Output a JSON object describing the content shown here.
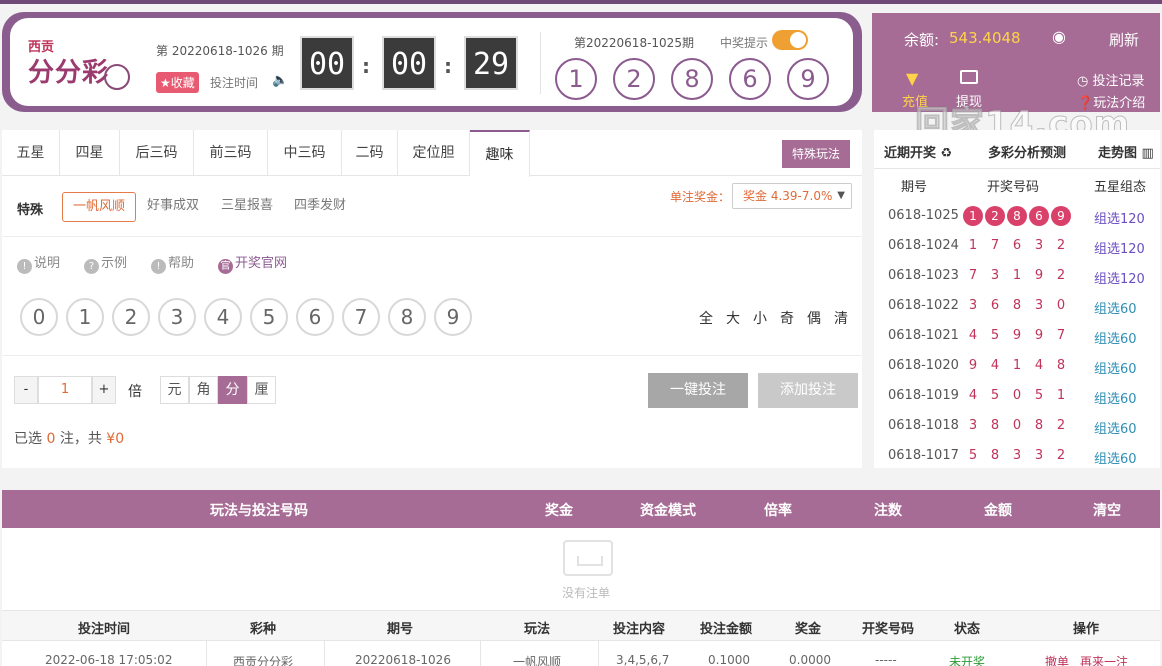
{
  "header": {
    "logo_small": "西贡",
    "logo_main": "分分彩",
    "current_issue": "第 20220618-1026 期",
    "favorite_label": "收藏",
    "bet_time_label": "投注时间",
    "countdown": [
      "00",
      "00",
      "29"
    ],
    "last_issue": "第20220618-1025期",
    "win_notice_label": "中奖提示",
    "last_result": [
      "1",
      "2",
      "8",
      "6",
      "9"
    ]
  },
  "account": {
    "balance_label": "余额:",
    "balance": "543.4048",
    "refresh_label": "刷新",
    "recharge_label": "充值",
    "withdraw_label": "提现",
    "records_label": "投注记录",
    "rules_label": "玩法介绍",
    "watermark": "回家14.com"
  },
  "tabs": [
    "五星",
    "四星",
    "后三码",
    "前三码",
    "中三码",
    "二码",
    "定位胆",
    "趣味"
  ],
  "active_tab": "趣味",
  "special_button": "特殊玩法",
  "subplay": {
    "title": "特殊",
    "options": [
      "一帆风顺",
      "好事成双",
      "三星报喜",
      "四季发财"
    ],
    "active": "一帆风顺"
  },
  "prize": {
    "label": "单注奖金：",
    "value": "奖金 4.39-7.0%"
  },
  "info_links": [
    "说明",
    "示例",
    "帮助",
    "开奖官网"
  ],
  "digits": [
    "0",
    "1",
    "2",
    "3",
    "4",
    "5",
    "6",
    "7",
    "8",
    "9"
  ],
  "quick_select": [
    "全",
    "大",
    "小",
    "奇",
    "偶",
    "清"
  ],
  "multiplier": {
    "minus": "-",
    "value": "1",
    "plus": "+",
    "label": "倍"
  },
  "units": [
    "元",
    "角",
    "分",
    "厘"
  ],
  "active_unit": "分",
  "actions": {
    "one_click": "一键投注",
    "add": "添加投注"
  },
  "selection_summary": {
    "prefix": "已选",
    "count": "0",
    "middle": "注，共",
    "amount": "¥0"
  },
  "history": {
    "headers": [
      "近期开奖",
      "多彩分析预测",
      "走势图"
    ],
    "columns": [
      "期号",
      "开奖号码",
      "五星组态"
    ],
    "rows": [
      {
        "issue": "0618-1025",
        "nums": [
          "1",
          "2",
          "8",
          "6",
          "9"
        ],
        "group": "组选120"
      },
      {
        "issue": "0618-1024",
        "nums": [
          "1",
          "7",
          "6",
          "3",
          "2"
        ],
        "group": "组选120"
      },
      {
        "issue": "0618-1023",
        "nums": [
          "7",
          "3",
          "1",
          "9",
          "2"
        ],
        "group": "组选120"
      },
      {
        "issue": "0618-1022",
        "nums": [
          "3",
          "6",
          "8",
          "3",
          "0"
        ],
        "group": "组选60"
      },
      {
        "issue": "0618-1021",
        "nums": [
          "4",
          "5",
          "9",
          "9",
          "7"
        ],
        "group": "组选60"
      },
      {
        "issue": "0618-1020",
        "nums": [
          "9",
          "4",
          "1",
          "4",
          "8"
        ],
        "group": "组选60"
      },
      {
        "issue": "0618-1019",
        "nums": [
          "4",
          "5",
          "0",
          "5",
          "1"
        ],
        "group": "组选60"
      },
      {
        "issue": "0618-1018",
        "nums": [
          "3",
          "8",
          "0",
          "8",
          "2"
        ],
        "group": "组选60"
      },
      {
        "issue": "0618-1017",
        "nums": [
          "5",
          "8",
          "3",
          "3",
          "2"
        ],
        "group": "组选60"
      }
    ]
  },
  "cart": {
    "columns": [
      "玩法与投注号码",
      "奖金",
      "资金模式",
      "倍率",
      "注数",
      "金额",
      "清空"
    ],
    "empty_text": "没有注单"
  },
  "records": {
    "columns": [
      "投注时间",
      "彩种",
      "期号",
      "玩法",
      "投注内容",
      "投注金额",
      "奖金",
      "开奖号码",
      "状态",
      "操作"
    ],
    "row": {
      "time": "2022-06-18 17:05:02",
      "lottery": "西贡分分彩",
      "issue": "20220618-1026",
      "play": "一帆风顺",
      "content": "3,4,5,6,7",
      "amount": "0.1000",
      "prize": "0.0000",
      "result": "-----",
      "status": "未开奖",
      "cancel": "撤单",
      "again": "再来一注"
    }
  },
  "colors": {
    "brand": "#a66c95",
    "accent": "#e06a36",
    "ball_red": "#d9406a"
  }
}
